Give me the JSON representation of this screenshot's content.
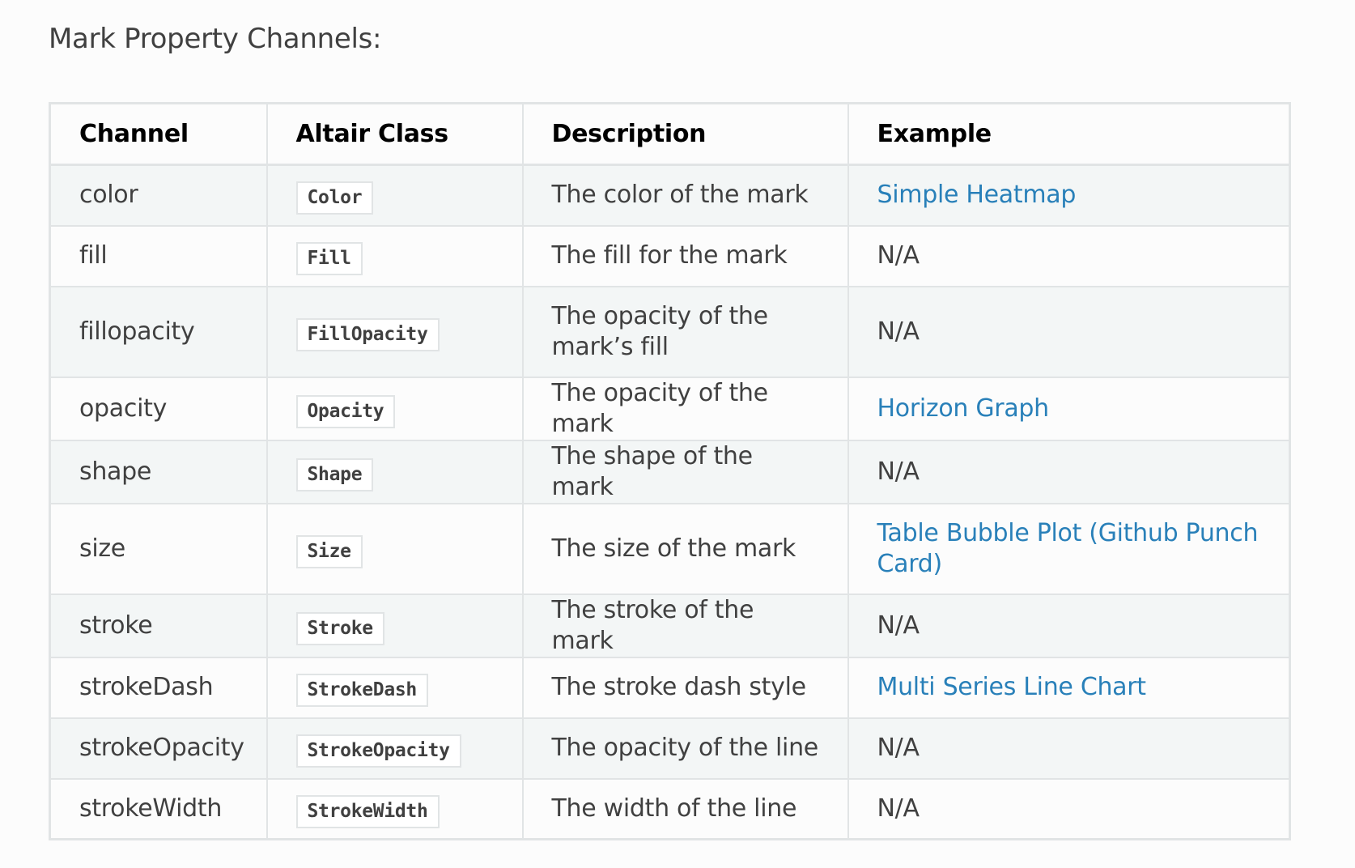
{
  "heading": "Mark Property Channels:",
  "table": {
    "headers": [
      "Channel",
      "Altair Class",
      "Description",
      "Example"
    ],
    "rows": [
      {
        "channel": "color",
        "altair_class": "Color",
        "description": "The color of the mark",
        "example": "Simple Heatmap",
        "example_is_link": true
      },
      {
        "channel": "fill",
        "altair_class": "Fill",
        "description": "The fill for the mark",
        "example": "N/A",
        "example_is_link": false
      },
      {
        "channel": "fillopacity",
        "altair_class": "FillOpacity",
        "description": "The opacity of the mark’s fill",
        "example": "N/A",
        "example_is_link": false
      },
      {
        "channel": "opacity",
        "altair_class": "Opacity",
        "description": "The opacity of the mark",
        "example": "Horizon Graph",
        "example_is_link": true
      },
      {
        "channel": "shape",
        "altair_class": "Shape",
        "description": "The shape of the mark",
        "example": "N/A",
        "example_is_link": false
      },
      {
        "channel": "size",
        "altair_class": "Size",
        "description": "The size of the mark",
        "example": "Table Bubble Plot (Github Punch Card)",
        "example_is_link": true
      },
      {
        "channel": "stroke",
        "altair_class": "Stroke",
        "description": "The stroke of the mark",
        "example": "N/A",
        "example_is_link": false
      },
      {
        "channel": "strokeDash",
        "altair_class": "StrokeDash",
        "description": "The stroke dash style",
        "example": "Multi Series Line Chart",
        "example_is_link": true
      },
      {
        "channel": "strokeOpacity",
        "altair_class": "StrokeOpacity",
        "description": "The opacity of the line",
        "example": "N/A",
        "example_is_link": false
      },
      {
        "channel": "strokeWidth",
        "altair_class": "StrokeWidth",
        "description": "The width of the line",
        "example": "N/A",
        "example_is_link": false
      }
    ]
  },
  "colors": {
    "link": "#2980b9",
    "text": "#404040",
    "header_text": "#000000",
    "row_stripe": "#f3f6f6",
    "row_plain": "#fcfcfc",
    "border": "#e1e4e5"
  }
}
